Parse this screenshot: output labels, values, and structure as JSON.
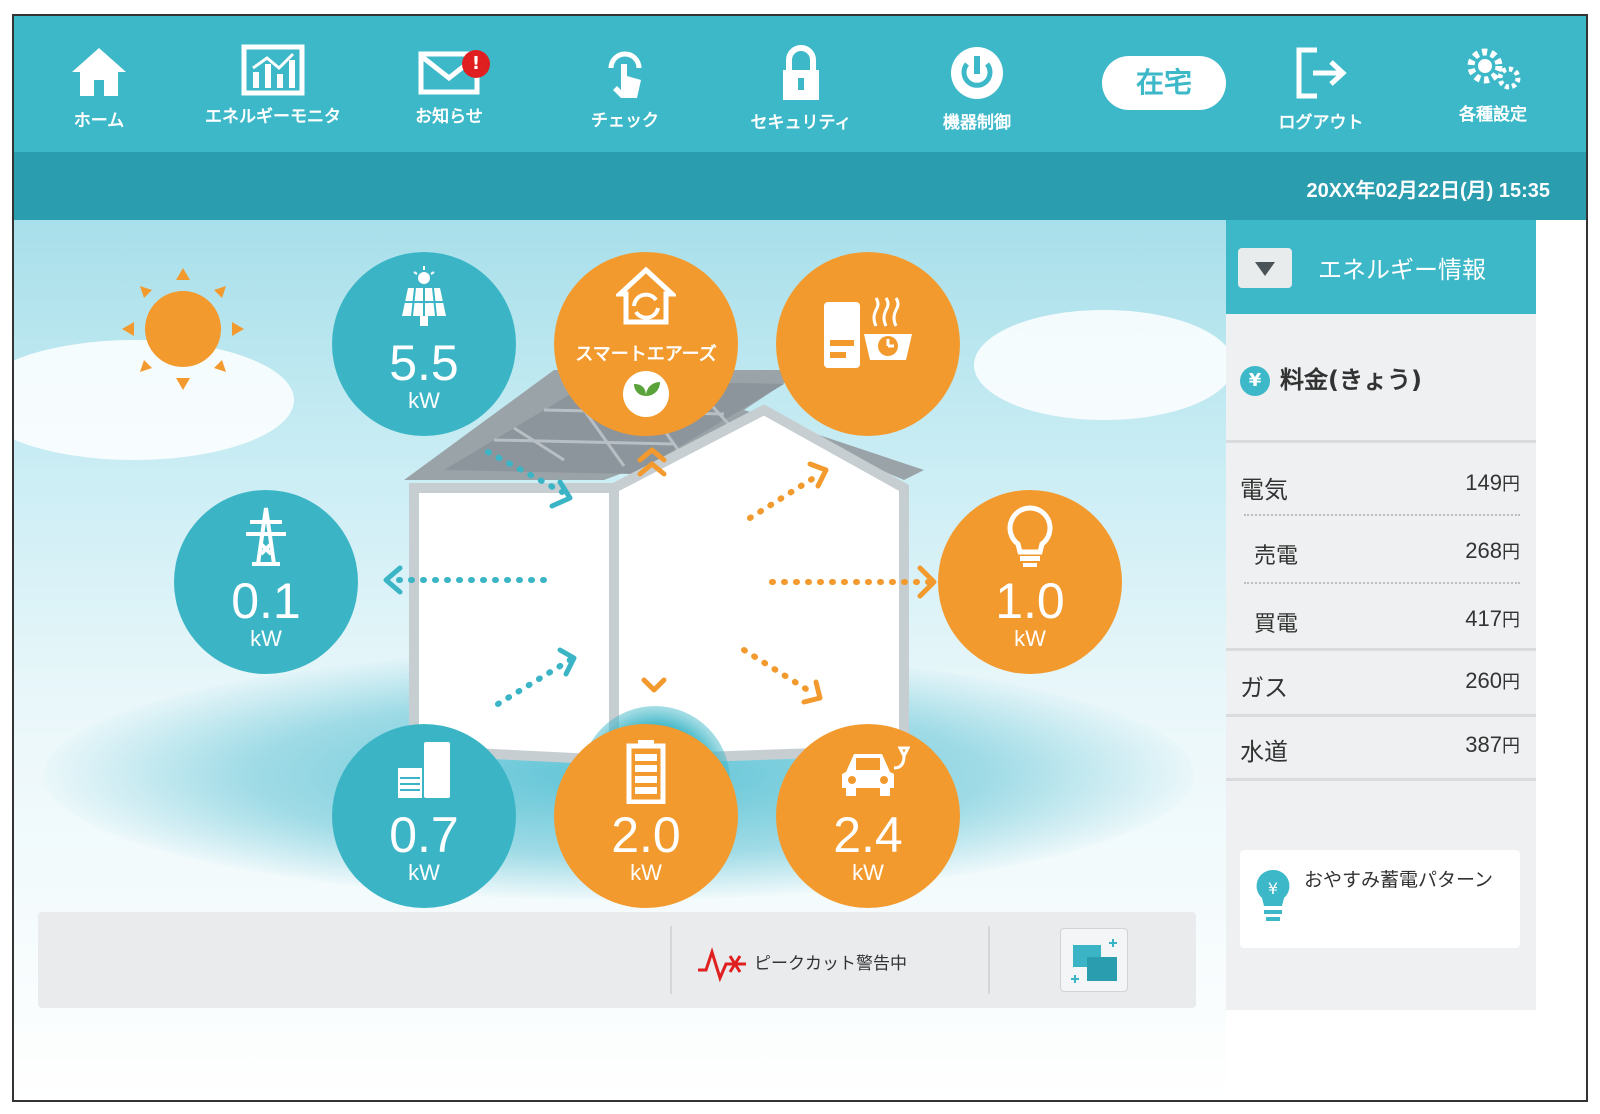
{
  "nav": {
    "home": "ホーム",
    "energy_monitor": "エネルギーモニタ",
    "notice": "お知らせ",
    "notice_badge": "!",
    "check": "チェック",
    "security": "セキュリティ",
    "device_control": "機器制御",
    "presence": "在宅",
    "logout": "ログアウト",
    "settings": "各種設定"
  },
  "datetime": "20XX年02月22日(月) 15:35",
  "flow": {
    "solar": {
      "value": "5.5",
      "unit": "kW"
    },
    "grid": {
      "value": "0.1",
      "unit": "kW"
    },
    "storage": {
      "value": "0.7",
      "unit": "kW"
    },
    "smart_air": {
      "label": "スマートエアーズ"
    },
    "consumption": {
      "value": "1.0",
      "unit": "kW"
    },
    "battery": {
      "value": "2.0",
      "unit": "kW"
    },
    "ev": {
      "value": "2.4",
      "unit": "kW"
    }
  },
  "bottom": {
    "peak_cut": "ピークカット警告中"
  },
  "sidebar": {
    "title": "エネルギー情報",
    "fee_title": "料金(きょう)",
    "yen_symbol": "¥",
    "rows": [
      {
        "label": "電気",
        "amount": "149",
        "unit": "円"
      },
      {
        "label": "売電",
        "amount": "268",
        "unit": "円"
      },
      {
        "label": "買電",
        "amount": "417",
        "unit": "円"
      },
      {
        "label": "ガス",
        "amount": "260",
        "unit": "円"
      },
      {
        "label": "水道",
        "amount": "387",
        "unit": "円"
      }
    ],
    "tip": "おやすみ蓄電パターン"
  },
  "colors": {
    "teal": "#3db8c8",
    "orange": "#f39a2e",
    "dark_teal": "#2a9daf"
  }
}
